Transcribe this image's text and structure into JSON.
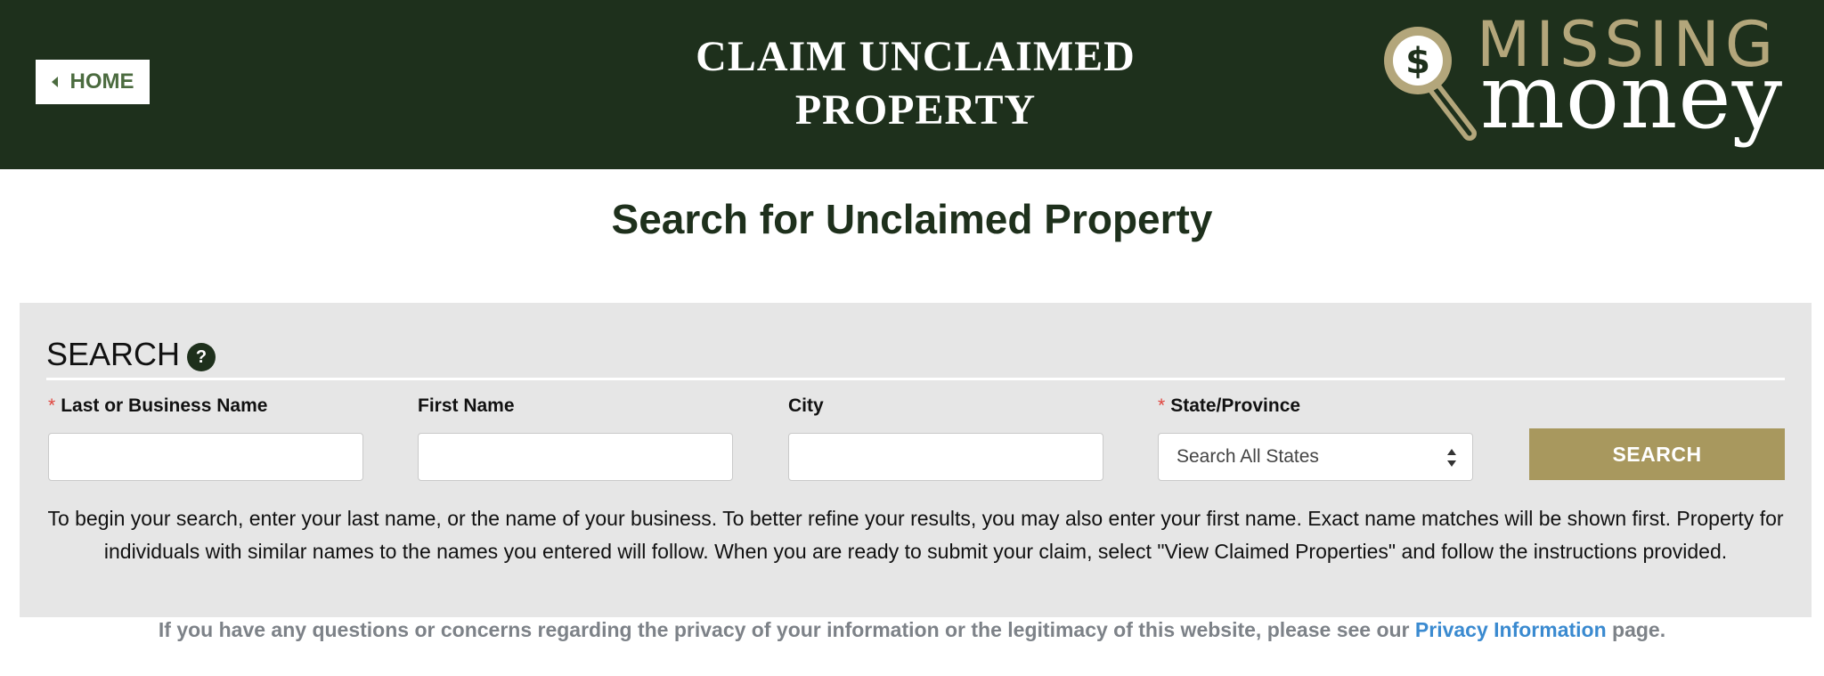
{
  "header": {
    "home_label": "HOME",
    "title_line1": "CLAIM UNCLAIMED",
    "title_line2": "PROPERTY",
    "logo_word1": "MISSING",
    "logo_word2": "money"
  },
  "main": {
    "heading": "Search for Unclaimed Property"
  },
  "search": {
    "title": "SEARCH",
    "help_glyph": "?",
    "fields": [
      {
        "label": "Last or Business Name",
        "required": true,
        "value": "",
        "placeholder": ""
      },
      {
        "label": "First Name",
        "required": false,
        "value": "",
        "placeholder": ""
      },
      {
        "label": "City",
        "required": false,
        "value": "",
        "placeholder": ""
      },
      {
        "label": "State/Province",
        "required": true,
        "selected": "Search All States"
      }
    ],
    "required_mark": "*",
    "button_label": "SEARCH",
    "instructions_line1": "To begin your search, enter your last name, or the name of your business.  To better refine your results, you may also enter your first name.  Exact name matches will be shown first.  Property for",
    "instructions_line2": "individuals with similar names to the names you entered will follow.  When you are ready to submit your claim, select \"View Claimed Properties\" and follow the instructions provided."
  },
  "footer": {
    "privacy_before": "If you have any questions or concerns regarding the privacy of your information or the legitimacy of this website, please see our ",
    "privacy_link": "Privacy Information",
    "privacy_after": " page."
  },
  "colors": {
    "header_bg": "#1e301c",
    "accent_gold": "#a8985e",
    "panel_bg": "#e6e6e6",
    "link": "#3a8ad0",
    "required": "#e0453e"
  },
  "icons": [
    "caret-left-icon",
    "help-icon",
    "magnifier-dollar-icon",
    "select-arrows-icon"
  ]
}
